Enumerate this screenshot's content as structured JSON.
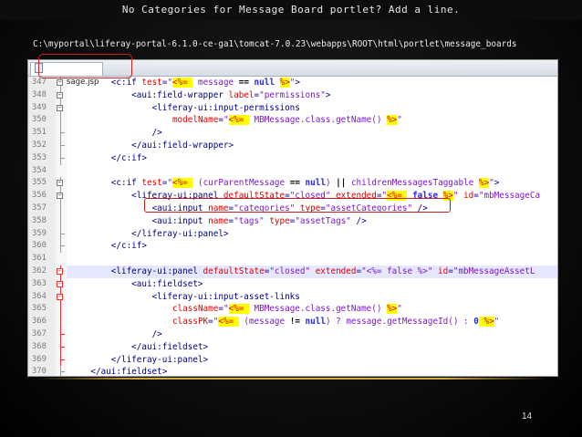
{
  "slide": {
    "title": "No Categories for Message Board portlet? Add a line.",
    "path": "C:\\myportal\\liferay-portal-6.1.0-ce-ga1\\tomcat-7.0.23\\webapps\\ROOT\\html\\portlet\\message_boards",
    "page_number": "14"
  },
  "editor": {
    "tab_label": "edit_message.jsp",
    "lines": [
      {
        "n": "347",
        "fold": "open",
        "segs": [
          [
            "sp",
            "        "
          ],
          [
            "tg",
            "<c:if "
          ],
          [
            "at",
            "test"
          ],
          [
            "tg",
            "="
          ],
          [
            "av",
            "\""
          ],
          [
            "sc",
            "<%= "
          ],
          [
            "av",
            " message "
          ],
          [
            "op",
            "=="
          ],
          [
            "kw",
            " null "
          ],
          [
            "sc",
            "%>"
          ],
          [
            "av",
            "\""
          ],
          [
            "tg",
            ">"
          ]
        ]
      },
      {
        "n": "348",
        "fold": "open",
        "segs": [
          [
            "sp",
            "            "
          ],
          [
            "tg",
            "<aui:field-wrapper "
          ],
          [
            "at",
            "label"
          ],
          [
            "tg",
            "="
          ],
          [
            "av",
            "\"permissions\""
          ],
          [
            "tg",
            ">"
          ]
        ]
      },
      {
        "n": "349",
        "fold": "open",
        "segs": [
          [
            "sp",
            "                "
          ],
          [
            "tg",
            "<liferay-ui:input-permissions"
          ]
        ]
      },
      {
        "n": "350",
        "fold": "line",
        "segs": [
          [
            "sp",
            "                    "
          ],
          [
            "at",
            "modelName"
          ],
          [
            "tg",
            "="
          ],
          [
            "av",
            "\""
          ],
          [
            "sc",
            "<%= "
          ],
          [
            "av",
            " MBMessage.class.getName() "
          ],
          [
            "sc",
            "%>"
          ],
          [
            "av",
            "\""
          ]
        ]
      },
      {
        "n": "351",
        "fold": "end",
        "segs": [
          [
            "sp",
            "                "
          ],
          [
            "tg",
            "/>"
          ]
        ]
      },
      {
        "n": "352",
        "fold": "end",
        "segs": [
          [
            "sp",
            "            "
          ],
          [
            "tg",
            "</aui:field-wrapper>"
          ]
        ]
      },
      {
        "n": "353",
        "fold": "end",
        "segs": [
          [
            "sp",
            "        "
          ],
          [
            "tg",
            "</c:if>"
          ]
        ]
      },
      {
        "n": "354",
        "fold": "none",
        "segs": []
      },
      {
        "n": "355",
        "fold": "open",
        "segs": [
          [
            "sp",
            "        "
          ],
          [
            "tg",
            "<c:if "
          ],
          [
            "at",
            "test"
          ],
          [
            "tg",
            "="
          ],
          [
            "av",
            "\""
          ],
          [
            "sc",
            "<%= "
          ],
          [
            "av",
            " (curParentMessage "
          ],
          [
            "op",
            "=="
          ],
          [
            "kw",
            " null"
          ],
          [
            "av",
            ") "
          ],
          [
            "op",
            "||"
          ],
          [
            "av",
            " childrenMessagesTaggable "
          ],
          [
            "sc",
            "%>"
          ],
          [
            "av",
            "\""
          ],
          [
            "tg",
            ">"
          ]
        ]
      },
      {
        "n": "356",
        "fold": "open",
        "segs": [
          [
            "sp",
            "            "
          ],
          [
            "tg",
            "<liferay-ui:panel "
          ],
          [
            "at",
            "defaultState"
          ],
          [
            "tg",
            "="
          ],
          [
            "av",
            "\"closed\" "
          ],
          [
            "at",
            "extended"
          ],
          [
            "tg",
            "="
          ],
          [
            "av",
            "\""
          ],
          [
            "sc",
            "<%= "
          ],
          [
            "kw",
            " false "
          ],
          [
            "sc",
            "%>"
          ],
          [
            "av",
            "\" "
          ],
          [
            "at",
            "id"
          ],
          [
            "tg",
            "="
          ],
          [
            "av",
            "\"mbMessageCa"
          ]
        ]
      },
      {
        "n": "357",
        "fold": "line",
        "segs": [
          [
            "sp",
            "                "
          ],
          [
            "tg",
            "<aui:input "
          ],
          [
            "at",
            "name"
          ],
          [
            "tg",
            "="
          ],
          [
            "av",
            "\"categories\" "
          ],
          [
            "at",
            "type"
          ],
          [
            "tg",
            "="
          ],
          [
            "av",
            "\"assetCategories\" "
          ],
          [
            "tg",
            "/>"
          ]
        ]
      },
      {
        "n": "358",
        "fold": "line",
        "segs": [
          [
            "sp",
            "                "
          ],
          [
            "tg",
            "<aui:input "
          ],
          [
            "at",
            "name"
          ],
          [
            "tg",
            "="
          ],
          [
            "av",
            "\"tags\" "
          ],
          [
            "at",
            "type"
          ],
          [
            "tg",
            "="
          ],
          [
            "av",
            "\"assetTags\" "
          ],
          [
            "tg",
            "/>"
          ]
        ]
      },
      {
        "n": "359",
        "fold": "end",
        "segs": [
          [
            "sp",
            "            "
          ],
          [
            "tg",
            "</liferay-ui:panel>"
          ]
        ]
      },
      {
        "n": "360",
        "fold": "end",
        "segs": [
          [
            "sp",
            "        "
          ],
          [
            "tg",
            "</c:if>"
          ]
        ]
      },
      {
        "n": "361",
        "fold": "none",
        "segs": []
      },
      {
        "n": "362",
        "fold": "open-red",
        "hl": true,
        "segs": [
          [
            "sp",
            "        "
          ],
          [
            "tg",
            "<liferay-ui:panel "
          ],
          [
            "at",
            "defaultState"
          ],
          [
            "tg",
            "="
          ],
          [
            "av",
            "\"closed\" "
          ],
          [
            "at",
            "extended"
          ],
          [
            "tg",
            "="
          ],
          [
            "av",
            "\"<%= false %>\" "
          ],
          [
            "at",
            "id"
          ],
          [
            "tg",
            "="
          ],
          [
            "av",
            "\"mbMessageAssetL"
          ]
        ]
      },
      {
        "n": "363",
        "fold": "open-red",
        "segs": [
          [
            "sp",
            "            "
          ],
          [
            "tg",
            "<aui:fieldset>"
          ]
        ]
      },
      {
        "n": "364",
        "fold": "open-red",
        "segs": [
          [
            "sp",
            "                "
          ],
          [
            "tg",
            "<liferay-ui:input-asset-links"
          ]
        ]
      },
      {
        "n": "365",
        "fold": "line-red",
        "segs": [
          [
            "sp",
            "                    "
          ],
          [
            "at",
            "className"
          ],
          [
            "tg",
            "="
          ],
          [
            "av",
            "\""
          ],
          [
            "sc",
            "<%= "
          ],
          [
            "av",
            " MBMessage.class.getName() "
          ],
          [
            "sc",
            "%>"
          ],
          [
            "av",
            "\""
          ]
        ]
      },
      {
        "n": "366",
        "fold": "line-red",
        "segs": [
          [
            "sp",
            "                    "
          ],
          [
            "at",
            "classPK"
          ],
          [
            "tg",
            "="
          ],
          [
            "av",
            "\""
          ],
          [
            "sc",
            "<%= "
          ],
          [
            "av",
            " (message "
          ],
          [
            "op",
            "!="
          ],
          [
            "kw",
            " null"
          ],
          [
            "av",
            ") ? message.getMessageId() : "
          ],
          [
            "kw",
            "0"
          ],
          [
            "sc",
            " %>"
          ],
          [
            "av",
            "\""
          ]
        ]
      },
      {
        "n": "367",
        "fold": "end-red",
        "segs": [
          [
            "sp",
            "                "
          ],
          [
            "tg",
            "/>"
          ]
        ]
      },
      {
        "n": "368",
        "fold": "end-red",
        "segs": [
          [
            "sp",
            "            "
          ],
          [
            "tg",
            "</aui:fieldset>"
          ]
        ]
      },
      {
        "n": "369",
        "fold": "end-red",
        "segs": [
          [
            "sp",
            "        "
          ],
          [
            "tg",
            "</liferay-ui:panel>"
          ]
        ]
      },
      {
        "n": "370",
        "fold": "end",
        "segs": [
          [
            "sp",
            "    "
          ],
          [
            "tg",
            "</aui:fieldset>"
          ]
        ]
      }
    ]
  },
  "colors": {
    "highlight_box": "#cf2020",
    "background": "#0a0a0a",
    "rule": "#d4aa3c"
  }
}
